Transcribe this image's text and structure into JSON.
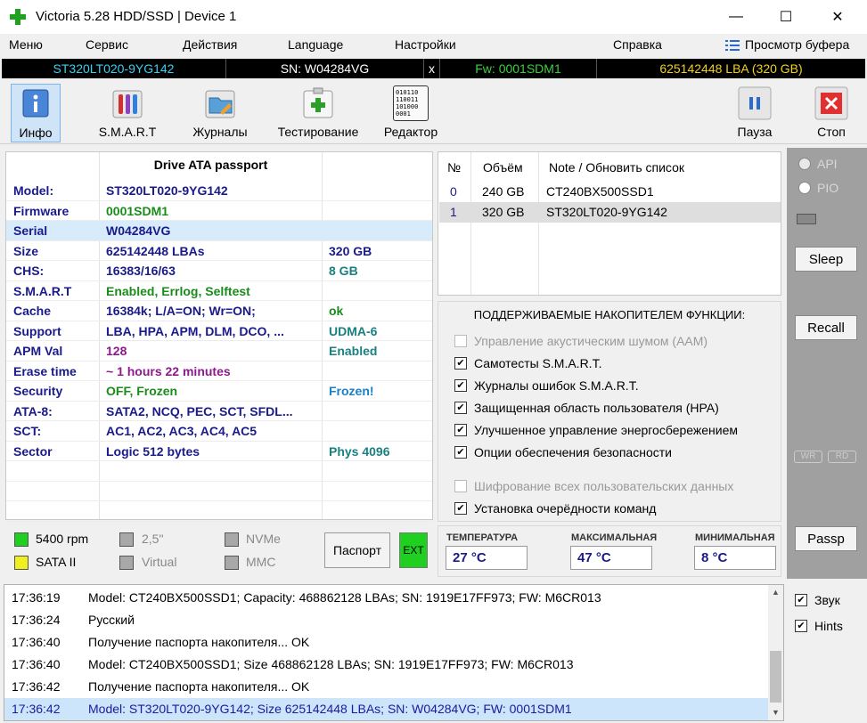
{
  "window": {
    "title": "Victoria 5.28 HDD/SSD | Device 1",
    "min": "—",
    "max": "☐",
    "close": "✕"
  },
  "menu": {
    "items": [
      "Меню",
      "Сервис",
      "Действия",
      "Language",
      "Настройки",
      "Справка"
    ],
    "buffer_view": "Просмотр буфера"
  },
  "strip": {
    "model": "ST320LT020-9YG142",
    "sn": "SN: W04284VG",
    "close_x": "x",
    "fw": "Fw: 0001SDM1",
    "lba": "625142448 LBA (320 GB)"
  },
  "toolbar": {
    "info": "Инфо",
    "smart": "S.M.A.R.T",
    "logs": "Журналы",
    "test": "Тестирование",
    "editor": "Редактор",
    "pause": "Пауза",
    "stop": "Стоп",
    "editor_glyph": "010110\n110011\n101000\n0001"
  },
  "passport": {
    "header": "Drive ATA passport",
    "rows": [
      {
        "k": "Model:",
        "v": "ST320LT020-9YG142",
        "x": "",
        "vcolor": "#1a1a8c",
        "xcolor": "#1a1a8c"
      },
      {
        "k": "Firmware",
        "v": "0001SDM1",
        "x": "",
        "vcolor": "#1a8c1a",
        "xcolor": "#1a1a8c"
      },
      {
        "k": "Serial",
        "v": "W04284VG",
        "x": "",
        "vcolor": "#1a1a8c",
        "xcolor": "#1a1a8c"
      },
      {
        "k": "Size",
        "v": "625142448 LBAs",
        "x": "320 GB",
        "vcolor": "#1a1a8c",
        "xcolor": "#1a1a8c"
      },
      {
        "k": "CHS:",
        "v": "16383/16/63",
        "x": "8 GB",
        "vcolor": "#1a1a8c",
        "xcolor": "#1a8080"
      },
      {
        "k": "S.M.A.R.T",
        "v": "Enabled, Errlog, Selftest",
        "x": "",
        "vcolor": "#1a8c1a",
        "xcolor": "#1a1a8c"
      },
      {
        "k": "Cache",
        "v": "16384k; L/A=ON; Wr=ON;",
        "x": "ok",
        "vcolor": "#1a1a8c",
        "xcolor": "#1a8c1a"
      },
      {
        "k": "Support",
        "v": "LBA, HPA, APM, DLM, DCO, ...",
        "x": "UDMA-6",
        "vcolor": "#1a1a8c",
        "xcolor": "#1a8080"
      },
      {
        "k": "APM Val",
        "v": "128",
        "x": "Enabled",
        "vcolor": "#8c1a8c",
        "xcolor": "#1a8080"
      },
      {
        "k": "Erase time",
        "v": "~ 1 hours 22 minutes",
        "x": "",
        "vcolor": "#8c1a8c",
        "xcolor": "#1a1a8c"
      },
      {
        "k": "Security",
        "v": "OFF, Frozen",
        "x": "Frozen!",
        "vcolor": "#1a8c1a",
        "xcolor": "#1a80c8"
      },
      {
        "k": "ATA-8:",
        "v": "SATA2, NCQ, PEC, SCT, SFDL...",
        "x": "",
        "vcolor": "#1a1a8c",
        "xcolor": "#1a1a8c"
      },
      {
        "k": "SCT:",
        "v": "AC1, AC2, AC3, AC4, AC5",
        "x": "",
        "vcolor": "#1a1a8c",
        "xcolor": "#1a1a8c"
      },
      {
        "k": "Sector",
        "v": "Logic 512 bytes",
        "x": "Phys 4096",
        "vcolor": "#1a1a8c",
        "xcolor": "#1a8080"
      }
    ]
  },
  "status": {
    "rpm": "5400 rpm",
    "sata": "SATA II",
    "ff": "2,5\"",
    "virtual": "Virtual",
    "nvme": "NVMe",
    "mmc": "MMC",
    "passport_btn": "Паспорт",
    "ext_btn": "EXT"
  },
  "drivelist": {
    "col_no": "№",
    "col_size": "Объём",
    "col_note": "Note / Обновить список",
    "rows": [
      {
        "no": "0",
        "size": "240 GB",
        "note": "CT240BX500SSD1"
      },
      {
        "no": "1",
        "size": "320 GB",
        "note": "ST320LT020-9YG142"
      }
    ]
  },
  "features": {
    "title": "ПОДДЕРЖИВАЕМЫЕ НАКОПИТЕЛЕМ ФУНКЦИИ:",
    "items": [
      {
        "label": "Управление акустическим шумом (AAM)",
        "checked": false,
        "enabled": false
      },
      {
        "label": "Самотесты S.M.A.R.T.",
        "checked": true,
        "enabled": true
      },
      {
        "label": "Журналы ошибок S.M.A.R.T.",
        "checked": true,
        "enabled": true
      },
      {
        "label": "Защищенная область пользователя (HPA)",
        "checked": true,
        "enabled": true
      },
      {
        "label": "Улучшенное управление энергосбережением",
        "checked": true,
        "enabled": true
      },
      {
        "label": "Опции обеспечения безопасности",
        "checked": true,
        "enabled": true
      },
      {
        "label": "Шифрование всех пользовательских данных",
        "checked": false,
        "enabled": false
      },
      {
        "label": "Установка очерёдности команд",
        "checked": true,
        "enabled": true
      }
    ]
  },
  "temps": {
    "cur_label": "ТЕМПЕРАТУРА",
    "cur": "27 °C",
    "max_label": "МАКСИМАЛЬНАЯ",
    "max": "47 °C",
    "min_label": "МИНИМАЛЬНАЯ",
    "min": "8 °C"
  },
  "right": {
    "api": "API",
    "pio": "PIO",
    "sleep": "Sleep",
    "recall": "Recall",
    "wr": "WR",
    "rd": "RD",
    "passp": "Passp"
  },
  "log": {
    "rows": [
      {
        "t": "17:36:19",
        "m": "Model: CT240BX500SSD1; Capacity: 468862128 LBAs; SN: 1919E17FF973; FW: M6CR013",
        "hl": false
      },
      {
        "t": "17:36:24",
        "m": "Русский",
        "hl": false
      },
      {
        "t": "17:36:40",
        "m": "Получение паспорта накопителя... OK",
        "hl": false
      },
      {
        "t": "17:36:40",
        "m": "Model: CT240BX500SSD1; Size 468862128 LBAs; SN: 1919E17FF973; FW: M6CR013",
        "hl": false
      },
      {
        "t": "17:36:42",
        "m": "Получение паспорта накопителя... OK",
        "hl": false
      },
      {
        "t": "17:36:42",
        "m": "Model: ST320LT020-9YG142; Size 625142448 LBAs; SN: W04284VG; FW: 0001SDM1",
        "hl": true
      }
    ]
  },
  "logopts": {
    "sound": "Звук",
    "hints": "Hints"
  }
}
